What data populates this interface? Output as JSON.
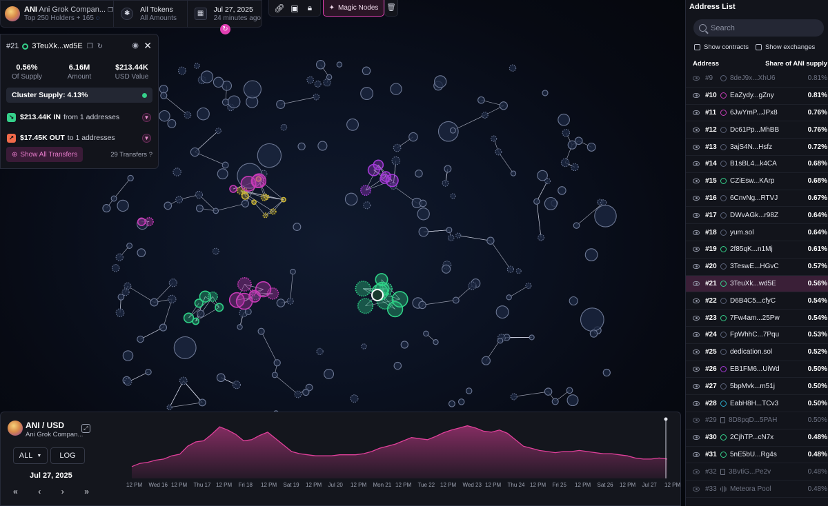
{
  "token": {
    "symbol": "ANI",
    "name": "Ani Grok Compan...",
    "holders": "Top 250 Holders + 165",
    "filter_title": "All Tokens",
    "filter_sub": "All Amounts",
    "date": "Jul 27, 2025",
    "ago": "24 minutes ago"
  },
  "toolbar": {
    "magic_label": "Magic Nodes",
    "icons": [
      "link-icon",
      "save-icon",
      "lock-icon"
    ]
  },
  "detail": {
    "rank": "#21",
    "address": "3TeuXk...wd5E",
    "stats": [
      {
        "value": "0.56%",
        "label": "Of Supply"
      },
      {
        "value": "6.16M",
        "label": "Amount"
      },
      {
        "value": "$213.44K",
        "label": "USD Value"
      }
    ],
    "cluster": "Cluster Supply: 4.13%",
    "in_amount": "$213.44K IN",
    "in_rest": "from 1 addresses",
    "out_amount": "$17.45K OUT",
    "out_rest": "to 1 addresses",
    "show_all": "Show All Transfers",
    "transfers": "29 Transfers"
  },
  "chart": {
    "pair": "ANI / USD",
    "name": "Ani Grok Compan...",
    "range": "ALL",
    "scale": "LOG",
    "date": "Jul 27, 2025",
    "color": "#e0409a"
  },
  "chart_data": {
    "type": "area",
    "title": "ANI / USD",
    "x_ticks": [
      "12 PM",
      "Wed 16",
      "12 PM",
      "Thu 17",
      "12 PM",
      "Fri 18",
      "12 PM",
      "Sat 19",
      "12 PM",
      "Jul 20",
      "12 PM",
      "Mon 21",
      "12 PM",
      "Tue 22",
      "12 PM",
      "Wed 23",
      "12 PM",
      "Thu 24",
      "12 PM",
      "Fri 25",
      "12 PM",
      "Sat 26",
      "12 PM",
      "Jul 27",
      "12 PM"
    ],
    "values": [
      0.22,
      0.28,
      0.3,
      0.34,
      0.36,
      0.42,
      0.45,
      0.6,
      0.68,
      0.7,
      0.82,
      0.96,
      0.9,
      0.82,
      0.7,
      0.72,
      0.8,
      0.86,
      0.74,
      0.62,
      0.5,
      0.46,
      0.44,
      0.42,
      0.42,
      0.42,
      0.44,
      0.44,
      0.44,
      0.46,
      0.5,
      0.56,
      0.6,
      0.64,
      0.7,
      0.76,
      0.74,
      0.72,
      0.78,
      0.85,
      0.9,
      0.94,
      0.98,
      0.94,
      0.88,
      0.86,
      0.9,
      0.84,
      0.72,
      0.6,
      0.56,
      0.52,
      0.5,
      0.48,
      0.5,
      0.5,
      0.52,
      0.5,
      0.48,
      0.46,
      0.46,
      0.44,
      0.42,
      0.38,
      0.36,
      0.36,
      0.38,
      0.36
    ]
  },
  "address_list": {
    "title": "Address List",
    "search_placeholder": "Search",
    "show_contracts": "Show contracts",
    "show_exchanges": "Show exchanges",
    "col_address": "Address",
    "col_share": "Share of ANI supply",
    "rows": [
      {
        "rank": "#9",
        "addr": "8deJ9x...XhU6",
        "share": "0.81%",
        "color": "#5a6278",
        "dim": true,
        "kind": "circle"
      },
      {
        "rank": "#10",
        "addr": "EaZydy...gZny",
        "share": "0.81%",
        "color": "#c53bb5",
        "dim": false,
        "kind": "circle"
      },
      {
        "rank": "#11",
        "addr": "6JwYmP...JPx8",
        "share": "0.76%",
        "color": "#c53bb5",
        "dim": false,
        "kind": "circle"
      },
      {
        "rank": "#12",
        "addr": "Dc61Pp...MhBB",
        "share": "0.76%",
        "color": "#5a6278",
        "dim": false,
        "kind": "circle"
      },
      {
        "rank": "#13",
        "addr": "3ajS4N...Hsfz",
        "share": "0.72%",
        "color": "#5a6278",
        "dim": false,
        "kind": "circle"
      },
      {
        "rank": "#14",
        "addr": "B1sBL4...k4CA",
        "share": "0.68%",
        "color": "#5a6278",
        "dim": false,
        "kind": "circle"
      },
      {
        "rank": "#15",
        "addr": "CZiEsw...KArp",
        "share": "0.68%",
        "color": "#35d08a",
        "dim": false,
        "kind": "circle"
      },
      {
        "rank": "#16",
        "addr": "6CnvNg...RTVJ",
        "share": "0.67%",
        "color": "#5a6278",
        "dim": false,
        "kind": "circle"
      },
      {
        "rank": "#17",
        "addr": "DWvAGk...r98Z",
        "share": "0.64%",
        "color": "#5a6278",
        "dim": false,
        "kind": "circle"
      },
      {
        "rank": "#18",
        "addr": "yum.sol",
        "share": "0.64%",
        "color": "#5a6278",
        "dim": false,
        "kind": "circle"
      },
      {
        "rank": "#19",
        "addr": "2f85qK...n1Mj",
        "share": "0.61%",
        "color": "#35d08a",
        "dim": false,
        "kind": "circle"
      },
      {
        "rank": "#20",
        "addr": "3TeswE...HGvC",
        "share": "0.57%",
        "color": "#5a6278",
        "dim": false,
        "kind": "circle"
      },
      {
        "rank": "#21",
        "addr": "3TeuXk...wd5E",
        "share": "0.56%",
        "color": "#35d08a",
        "dim": false,
        "kind": "circle",
        "selected": true
      },
      {
        "rank": "#22",
        "addr": "D6B4C5...cfyC",
        "share": "0.54%",
        "color": "#5a6278",
        "dim": false,
        "kind": "circle"
      },
      {
        "rank": "#23",
        "addr": "7Fw4am...25Pw",
        "share": "0.54%",
        "color": "#35d08a",
        "dim": false,
        "kind": "circle"
      },
      {
        "rank": "#24",
        "addr": "FpWhhC...7Pqu",
        "share": "0.53%",
        "color": "#5a6278",
        "dim": false,
        "kind": "circle"
      },
      {
        "rank": "#25",
        "addr": "dedication.sol",
        "share": "0.52%",
        "color": "#5a6278",
        "dim": false,
        "kind": "circle"
      },
      {
        "rank": "#26",
        "addr": "EB1FM6...UiWd",
        "share": "0.50%",
        "color": "#a43bd6",
        "dim": false,
        "kind": "circle"
      },
      {
        "rank": "#27",
        "addr": "5bpMvk...m51j",
        "share": "0.50%",
        "color": "#5a6278",
        "dim": false,
        "kind": "circle"
      },
      {
        "rank": "#28",
        "addr": "EabH8H...TCv3",
        "share": "0.50%",
        "color": "#2aa9c8",
        "dim": false,
        "kind": "circle"
      },
      {
        "rank": "#29",
        "addr": "8D8pqD...5PAH",
        "share": "0.50%",
        "color": "#5a6278",
        "dim": true,
        "kind": "doc"
      },
      {
        "rank": "#30",
        "addr": "2CjhTP...cN7x",
        "share": "0.48%",
        "color": "#35d08a",
        "dim": false,
        "kind": "circle"
      },
      {
        "rank": "#31",
        "addr": "5nE5bU...Rg4s",
        "share": "0.48%",
        "color": "#35d08a",
        "dim": false,
        "kind": "circle"
      },
      {
        "rank": "#32",
        "addr": "3BvtiG...Pe2v",
        "share": "0.48%",
        "color": "#5a6278",
        "dim": true,
        "kind": "doc"
      },
      {
        "rank": "#33",
        "addr": "Meteora Pool",
        "share": "0.48%",
        "color": "#5a6278",
        "dim": true,
        "kind": "meteora"
      }
    ]
  }
}
